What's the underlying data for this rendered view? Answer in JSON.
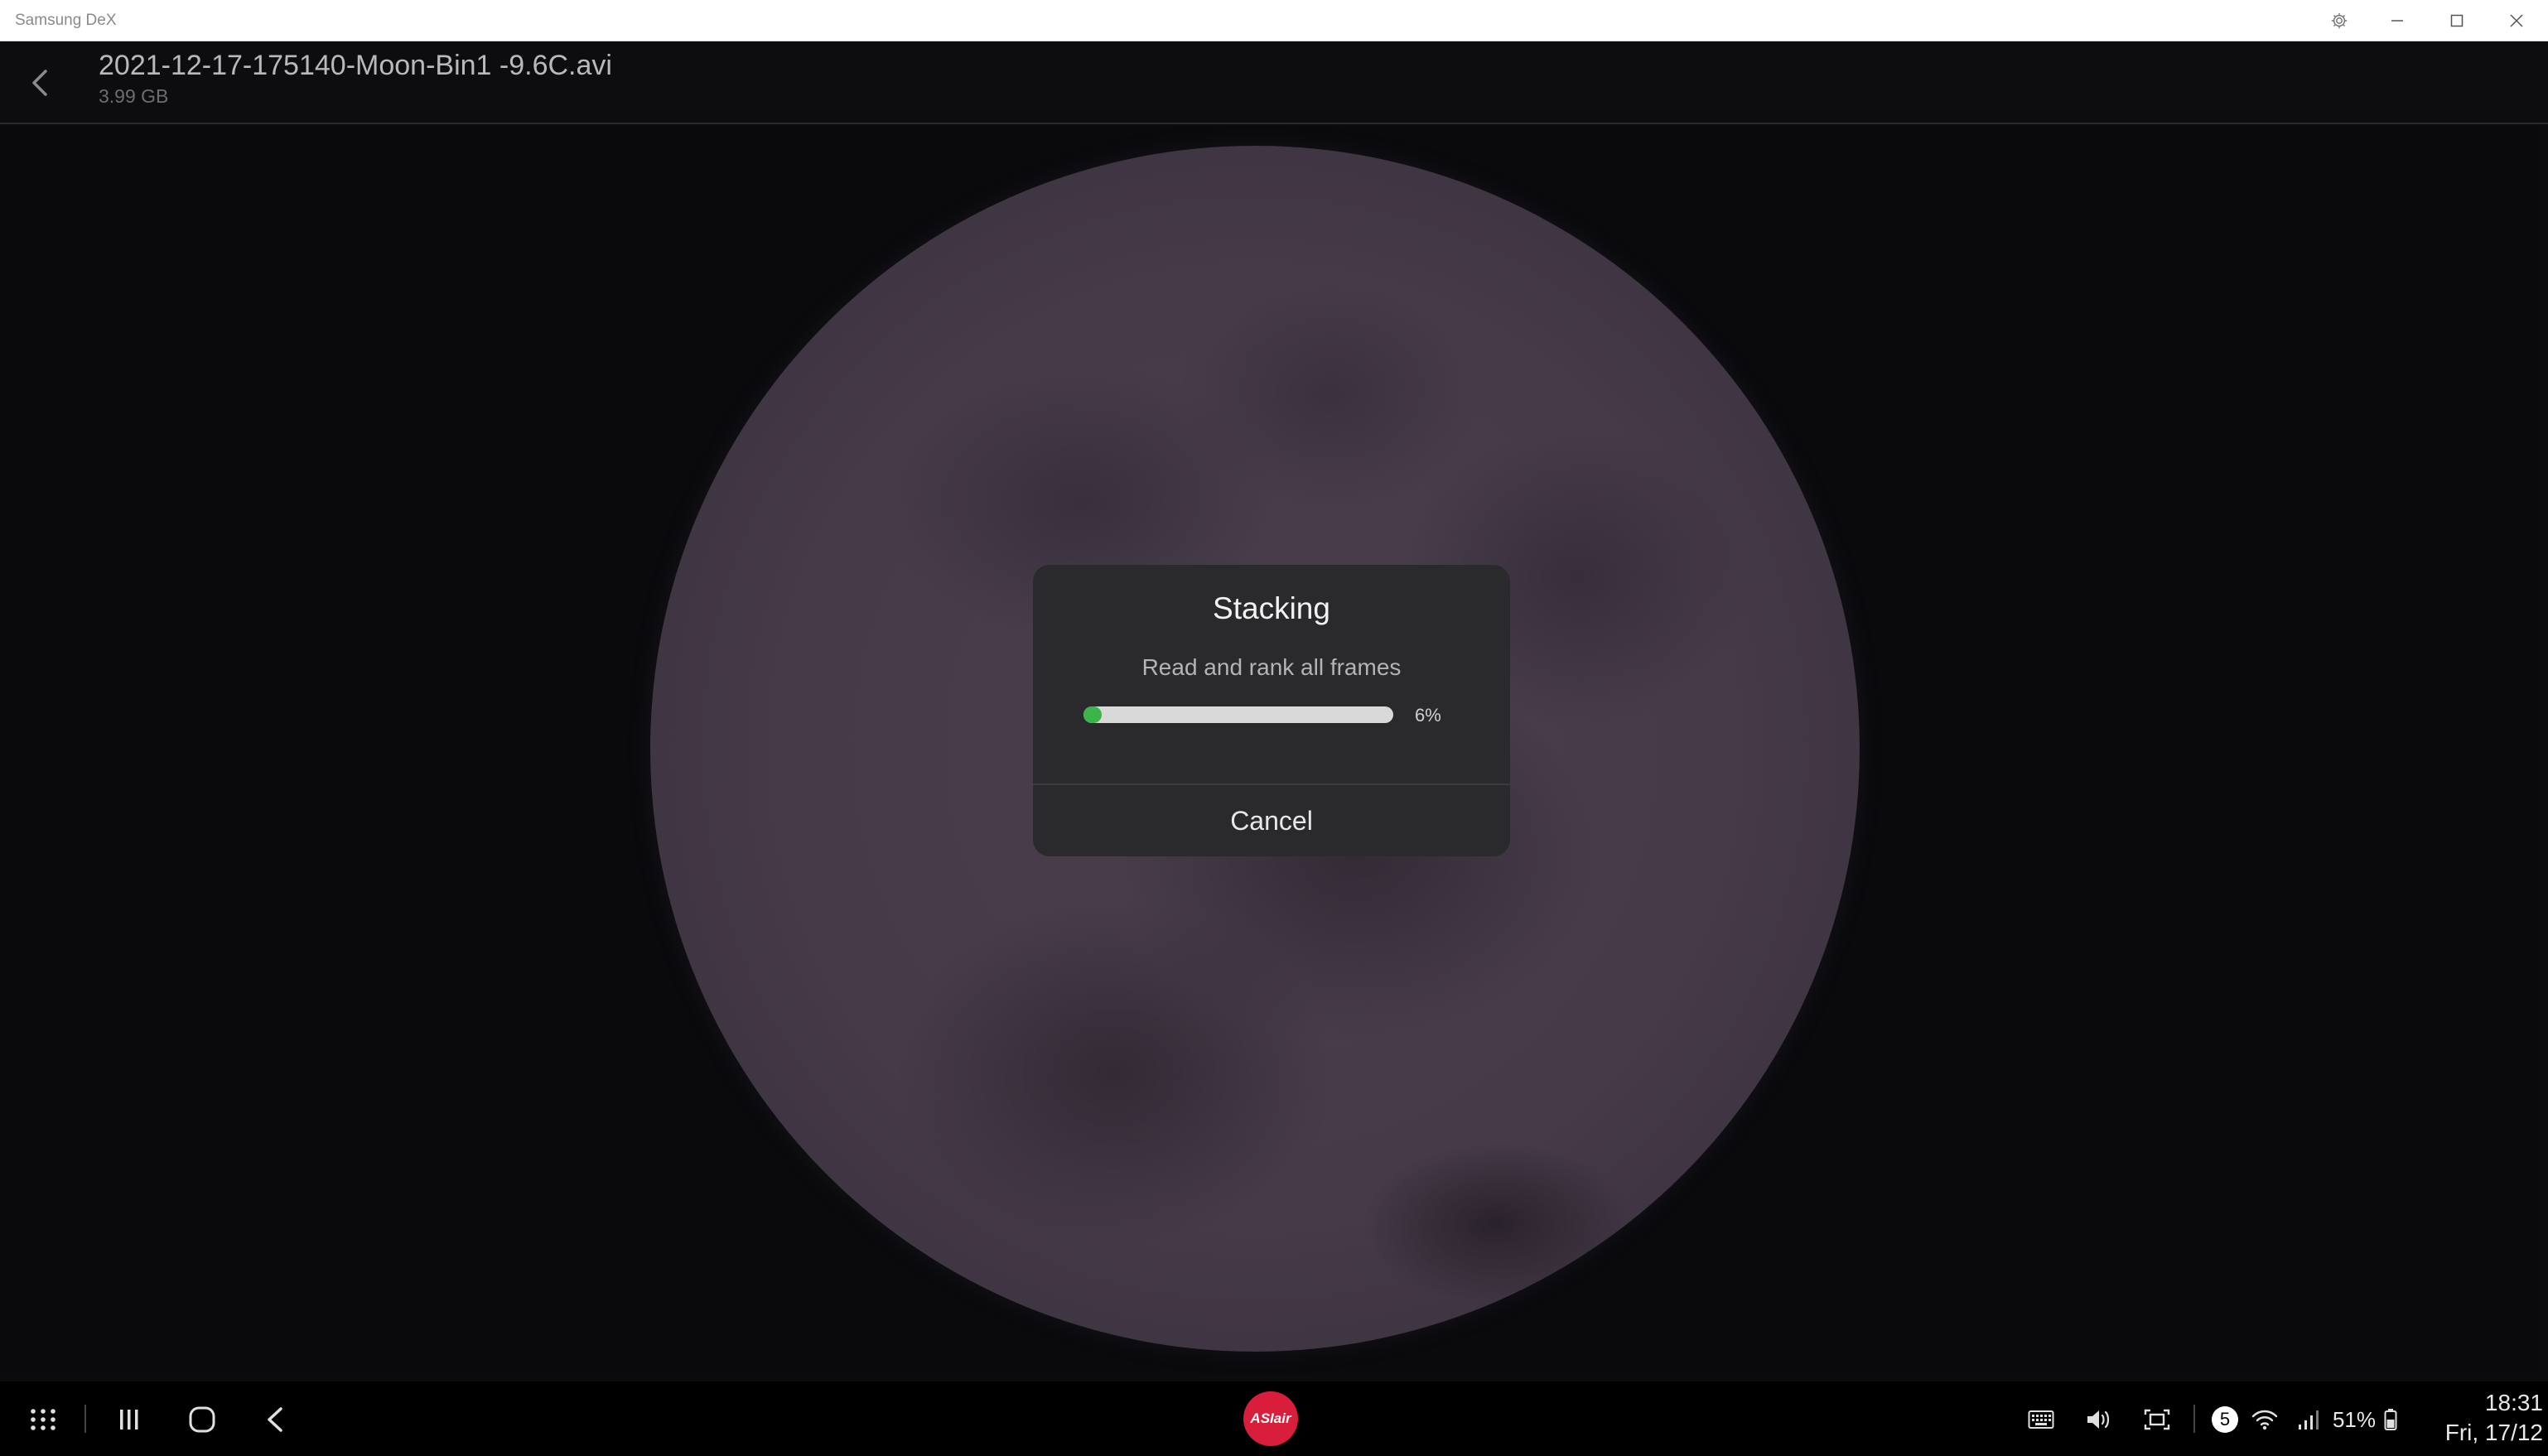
{
  "window": {
    "title": "Samsung DeX",
    "controls": {
      "settings_icon": "gear-icon",
      "minimize_icon": "minimize-icon",
      "maximize_icon": "maximize-icon",
      "close_icon": "close-icon"
    }
  },
  "header": {
    "back_icon": "chevron-left-icon",
    "file_name": "2021-12-17-175140-Moon-Bin1 -9.6C.avi",
    "file_size": "3.99 GB"
  },
  "dialog": {
    "title": "Stacking",
    "message": "Read and rank all frames",
    "progress": 0.06,
    "progress_label": "6%",
    "cancel_label": "Cancel",
    "progress_color": "#3bb54a"
  },
  "taskbar": {
    "app_label": "ASIair",
    "app_color": "#d81e3a",
    "notification_count": "5",
    "battery": "51%",
    "time": "18:31",
    "date": "Fri, 17/12"
  }
}
